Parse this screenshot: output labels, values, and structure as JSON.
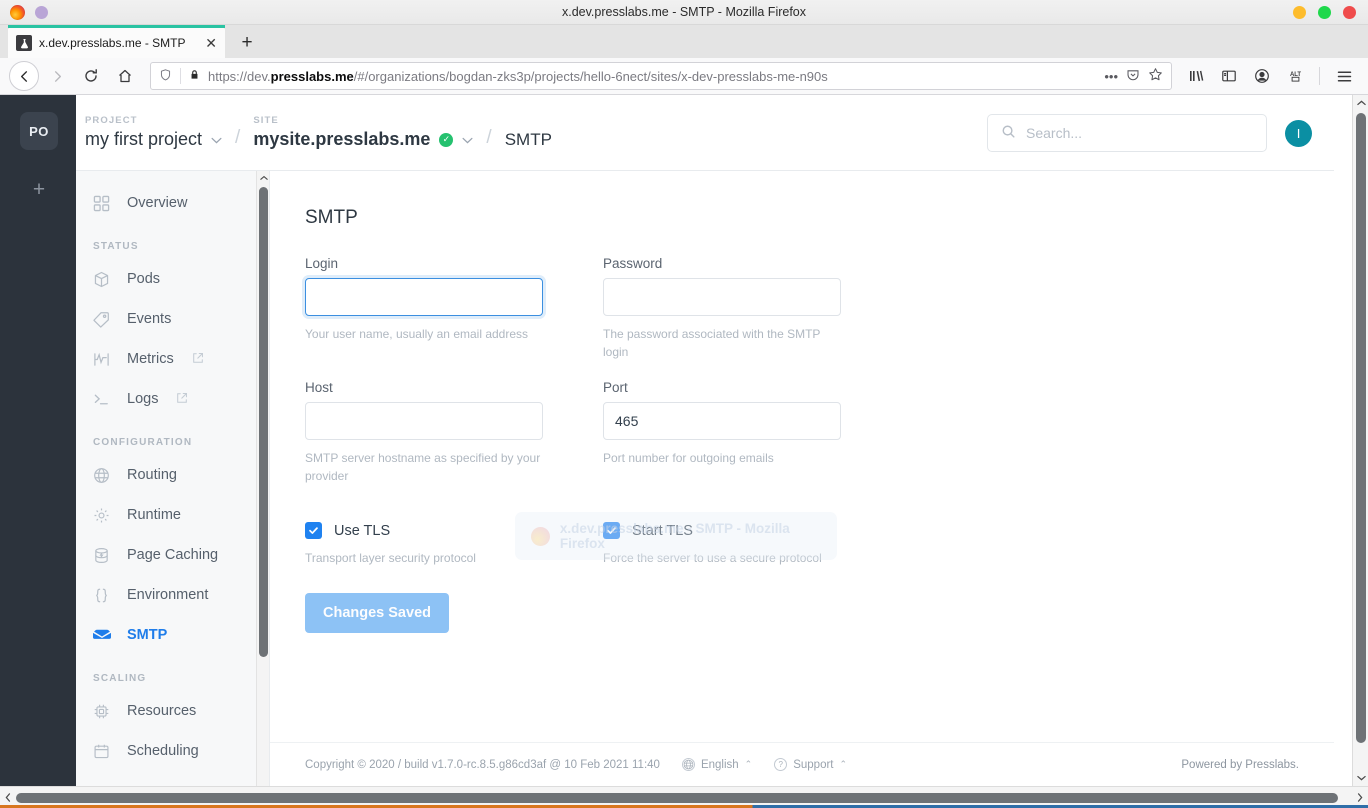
{
  "window": {
    "title": "x.dev.presslabs.me - SMTP - Mozilla Firefox",
    "controls": {
      "minimize": "minimize",
      "maximize": "maximize",
      "close": "close"
    }
  },
  "browser": {
    "tab": {
      "title": "x.dev.presslabs.me - SMTP",
      "favicon": "flask-icon",
      "close": "✕"
    },
    "new_tab": "+",
    "nav": {
      "back": "←",
      "forward": "→",
      "reload": "⟳",
      "home": "⌂"
    },
    "url": {
      "scheme_prefix": "https://dev.",
      "domain": "presslabs.me",
      "path": "/#/organizations/bogdan-zks3p/projects/hello-6nect/sites/x-dev-presslabs-me-n90s",
      "shield": "⛨",
      "lock": "ὑ2",
      "page_actions": "•••",
      "pocket": "save-to-pocket",
      "bookmark": "☆"
    },
    "toolbar_icons": [
      "library-icon",
      "sidebar-icon",
      "account-icon",
      "alt-text-icon",
      "menu-icon"
    ]
  },
  "rail": {
    "org_initials": "PO",
    "add_label": "+"
  },
  "header": {
    "project": {
      "eyebrow": "PROJECT",
      "name": "my first project",
      "chevron": "⌄"
    },
    "site": {
      "eyebrow": "SITE",
      "name": "mysite.presslabs.me",
      "verified_mark": "✓",
      "chevron": "⌄"
    },
    "current": "SMTP",
    "separator": "/",
    "search": {
      "placeholder": "Search...",
      "value": "",
      "icon": "search-icon"
    },
    "user_initial": "I"
  },
  "sidebar": {
    "items": [
      {
        "label": "Overview",
        "icon": "grid-icon",
        "active": false,
        "external": false
      },
      {
        "label": "Pods",
        "icon": "cube-icon",
        "active": false,
        "external": false
      },
      {
        "label": "Events",
        "icon": "tag-icon",
        "active": false,
        "external": false
      },
      {
        "label": "Metrics",
        "icon": "chart-icon",
        "active": false,
        "external": true
      },
      {
        "label": "Logs",
        "icon": "terminal-icon",
        "active": false,
        "external": true
      },
      {
        "label": "Routing",
        "icon": "globe-icon",
        "active": false,
        "external": false
      },
      {
        "label": "Runtime",
        "icon": "gear-icon",
        "active": false,
        "external": false
      },
      {
        "label": "Page Caching",
        "icon": "database-icon",
        "active": false,
        "external": false
      },
      {
        "label": "Environment",
        "icon": "braces-icon",
        "active": false,
        "external": false
      },
      {
        "label": "SMTP",
        "icon": "envelope-icon",
        "active": true,
        "external": false
      },
      {
        "label": "Resources",
        "icon": "cpu-icon",
        "active": false,
        "external": false
      },
      {
        "label": "Scheduling",
        "icon": "calendar-icon",
        "active": false,
        "external": false
      }
    ],
    "sections": {
      "status": "STATUS",
      "configuration": "CONFIGURATION",
      "scaling": "SCALING"
    }
  },
  "main": {
    "title": "SMTP",
    "fields": {
      "login": {
        "label": "Login",
        "value": "",
        "help": "Your user name, usually an email address",
        "focused": true
      },
      "password": {
        "label": "Password",
        "value": "",
        "help": "The password associated with the SMTP login",
        "focused": false
      },
      "host": {
        "label": "Host",
        "value": "",
        "help": "SMTP server hostname as specified by your provider",
        "focused": false
      },
      "port": {
        "label": "Port",
        "value": "465",
        "help": "Port number for outgoing emails",
        "focused": false
      }
    },
    "checkboxes": [
      {
        "label": "Use TLS",
        "checked": true,
        "help": "Transport layer security protocol",
        "mark": "✓"
      },
      {
        "label": "Start TLS",
        "checked": true,
        "help": "Force the server to use a secure protocol",
        "mark": "✓"
      }
    ],
    "save_button": {
      "label": "Changes Saved",
      "state": "saved"
    },
    "ghost_overlay": "x.dev.presslabs.me - SMTP - Mozilla Firefox"
  },
  "footer": {
    "copyright": "Copyright © 2020 / build v1.7.0-rc.8.5.g86cd3af @ 10 Feb 2021 11:40",
    "language": {
      "label": "English",
      "icon": "globe-icon",
      "caret": "⌃"
    },
    "support": {
      "label": "Support",
      "icon": "question-icon",
      "caret": "⌃"
    },
    "powered_by": "Powered by Presslabs."
  },
  "colors": {
    "accent_blue": "#1f7dea",
    "tab_accent": "#2ac3a2",
    "avatar_teal": "#0b8fa3",
    "verified_green": "#25c16f",
    "save_button": "#8dc2f5",
    "rail_dark": "#2c333c"
  }
}
